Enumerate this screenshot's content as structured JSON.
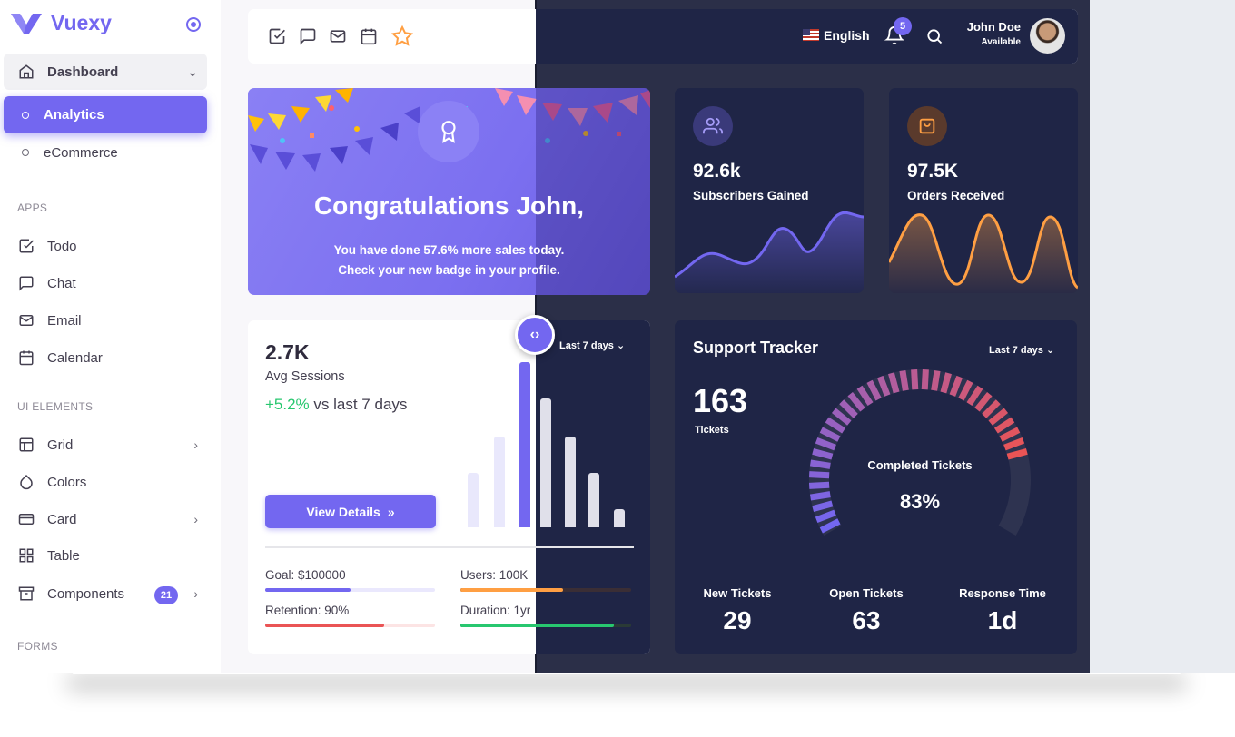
{
  "brand": {
    "name": "Vuexy"
  },
  "sidebar": {
    "items": [
      {
        "label": "Dashboard"
      },
      {
        "label": "Analytics"
      },
      {
        "label": "eCommerce"
      }
    ],
    "sections": {
      "apps": "APPS",
      "ui_elements": "UI ELEMENTS",
      "forms": "FORMS"
    },
    "apps": [
      {
        "label": "Todo",
        "icon": "check-square-icon"
      },
      {
        "label": "Chat",
        "icon": "message-square-icon"
      },
      {
        "label": "Email",
        "icon": "mail-icon"
      },
      {
        "label": "Calendar",
        "icon": "calendar-icon"
      }
    ],
    "ui": [
      {
        "label": "Grid",
        "icon": "layout-icon"
      },
      {
        "label": "Colors",
        "icon": "droplet-icon"
      },
      {
        "label": "Card",
        "icon": "credit-card-icon"
      },
      {
        "label": "Table",
        "icon": "grid-icon"
      },
      {
        "label": "Components",
        "icon": "archive-icon",
        "badge": "21"
      }
    ]
  },
  "topbar": {
    "language": "English",
    "notifications_count": "5",
    "user_name": "John Doe",
    "user_status": "Available",
    "shortcut_icons": [
      "check-square-icon",
      "message-square-icon",
      "mail-icon",
      "calendar-icon",
      "star-icon"
    ]
  },
  "congrats": {
    "title": "Congratulations John,",
    "line1_pre": "You have done ",
    "line1_highlight": "57.6%",
    "line1_post": " more sales today.",
    "line2": "Check your new badge in your profile."
  },
  "subscribers": {
    "value": "92.6k",
    "label": "Subscribers Gained",
    "color": "#7367f0"
  },
  "orders": {
    "value": "97.5K",
    "label": "Orders Received",
    "color": "#ff9f43"
  },
  "sessions": {
    "value": "2.7K",
    "label": "Avg Sessions",
    "growth": "+5.2%",
    "growth_suffix": " vs last 7 days",
    "button": "View Details",
    "range": "Last 7 days",
    "metrics": [
      {
        "label": "Goal: $100000",
        "fill": 0.5,
        "color": "#7367f0"
      },
      {
        "label": "Users: 100K",
        "fill": 0.6,
        "color": "#ff9f43"
      },
      {
        "label": "Retention: 90%",
        "fill": 0.7,
        "color": "#ea5455"
      },
      {
        "label": "Duration: 1yr",
        "fill": 0.9,
        "color": "#28c76f"
      }
    ]
  },
  "support": {
    "title": "Support Tracker",
    "range": "Last 7 days",
    "total": "163",
    "total_label": "Tickets",
    "center_label": "Completed Tickets",
    "center_value": "83%",
    "completed_fraction": 0.83,
    "stats": [
      {
        "label": "New Tickets",
        "value": "29"
      },
      {
        "label": "Open Tickets",
        "value": "63"
      },
      {
        "label": "Response Time",
        "value": "1d"
      }
    ]
  }
}
